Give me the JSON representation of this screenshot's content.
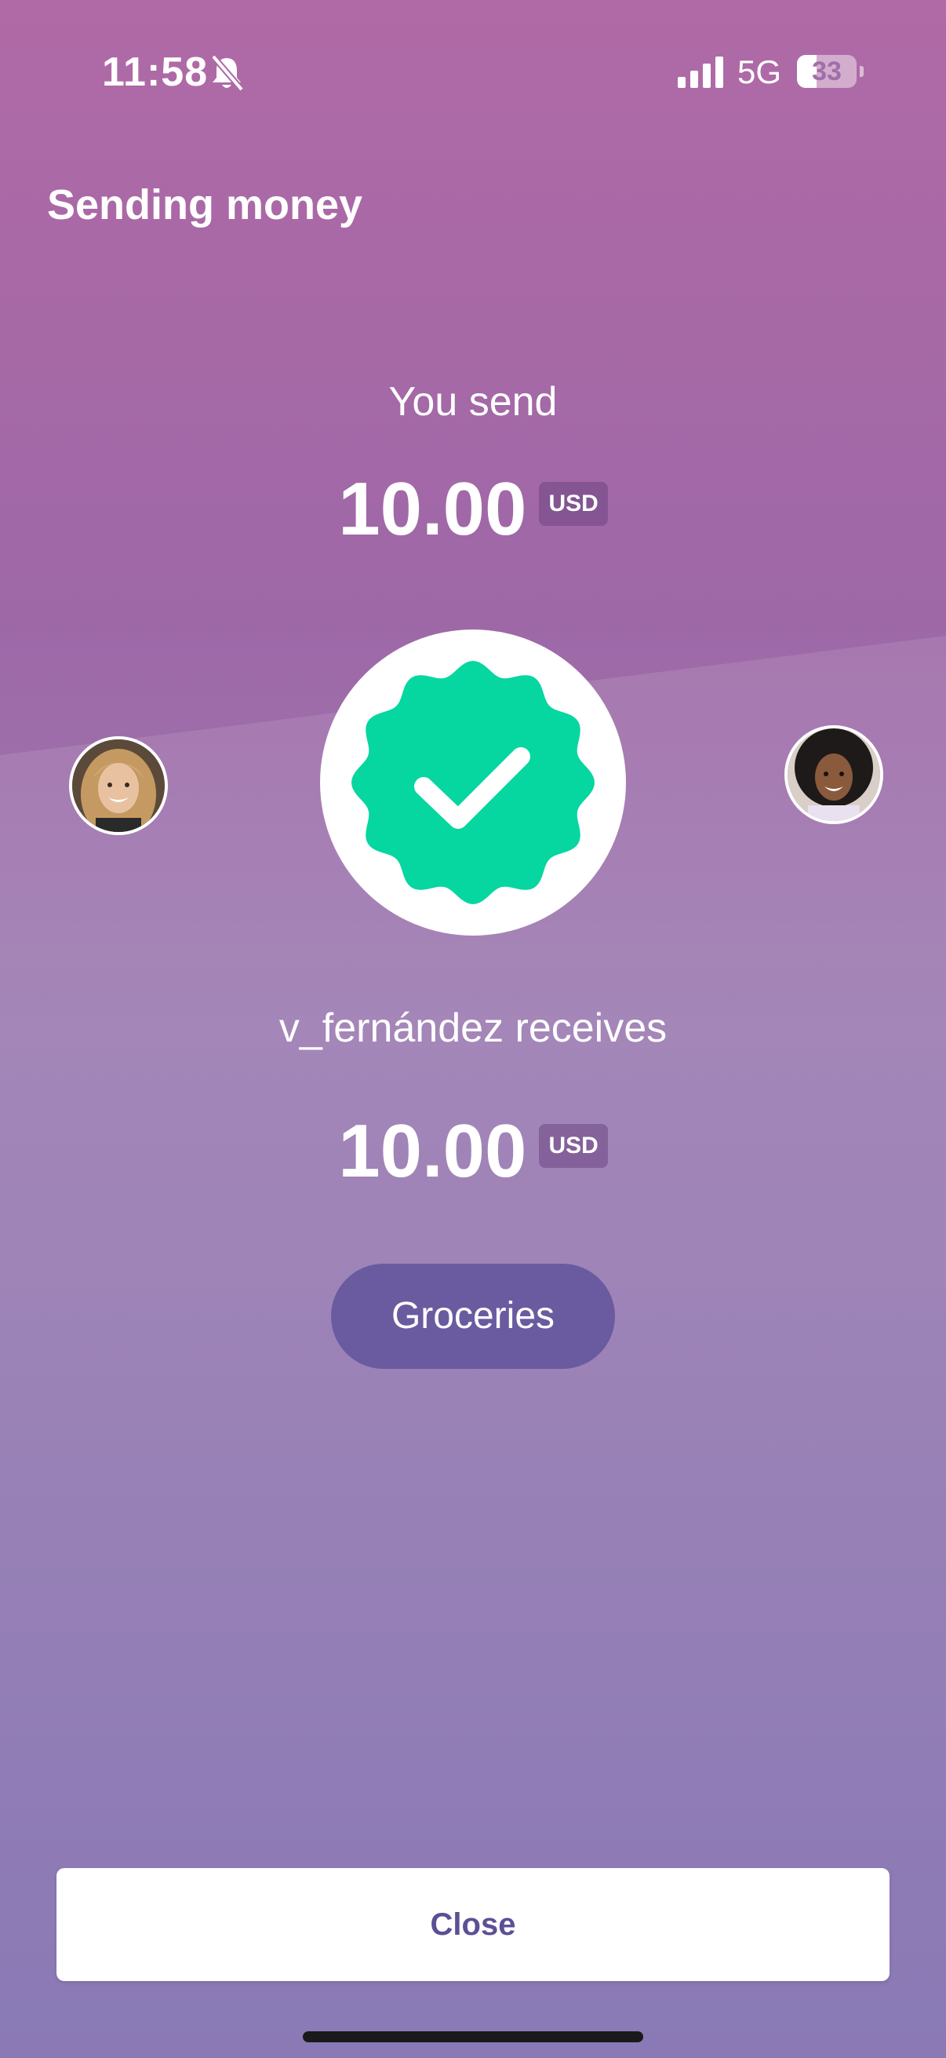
{
  "status_bar": {
    "time": "11:58",
    "network": "5G",
    "battery_level": "33",
    "battery_fraction": 0.33,
    "icons": [
      "bell-slash-icon",
      "cellular-signal-icon",
      "battery-icon"
    ]
  },
  "header": {
    "title": "Sending money"
  },
  "send": {
    "caption": "You send",
    "amount": "10.00",
    "currency": "USD"
  },
  "status": {
    "icon": "checkmark-badge-icon",
    "badge_color": "#06d6a0"
  },
  "sender": {
    "avatar_icon": "sender-avatar"
  },
  "recipient": {
    "avatar_icon": "recipient-avatar"
  },
  "receive": {
    "caption": "v_fernández receives",
    "amount": "10.00",
    "currency": "USD"
  },
  "category": {
    "label": "Groceries"
  },
  "actions": {
    "close_label": "Close"
  },
  "colors": {
    "accent": "#6a5ba0",
    "close_text": "#5c4f94",
    "success": "#06d6a0"
  }
}
